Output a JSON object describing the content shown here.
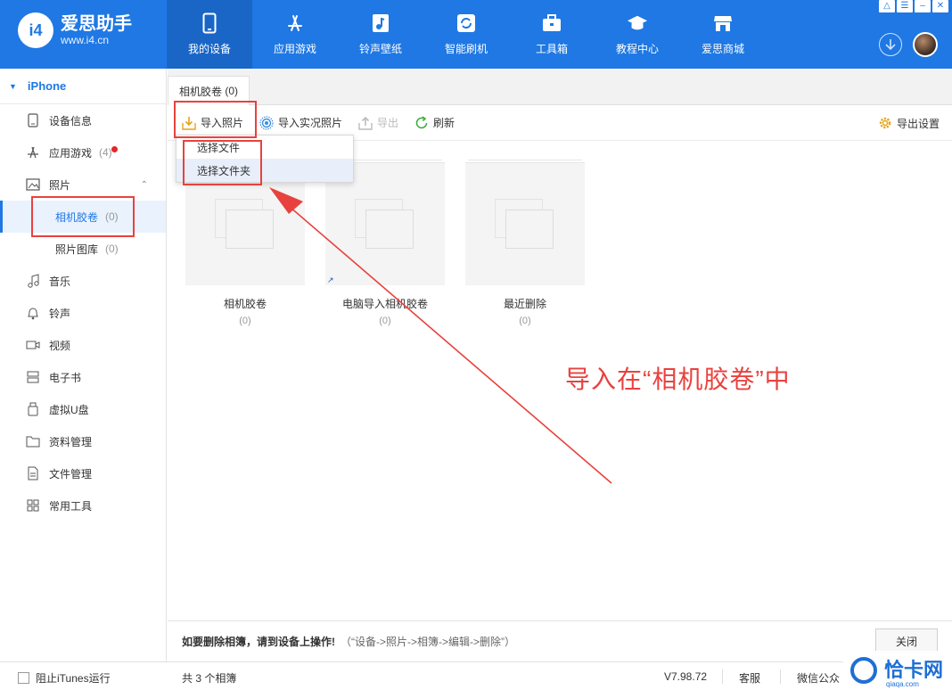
{
  "app": {
    "logo_badge": "i4",
    "name": "爱思助手",
    "url": "www.i4.cn",
    "window_controls": [
      "shirt-icon",
      "list-icon",
      "minimize-icon",
      "close-icon"
    ]
  },
  "nav": [
    {
      "label": "我的设备",
      "icon": "phone-icon",
      "active": true
    },
    {
      "label": "应用游戏",
      "icon": "appstore-icon"
    },
    {
      "label": "铃声壁纸",
      "icon": "music-file-icon"
    },
    {
      "label": "智能刷机",
      "icon": "refresh-box-icon"
    },
    {
      "label": "工具箱",
      "icon": "toolbox-icon"
    },
    {
      "label": "教程中心",
      "icon": "graduation-cap-icon"
    },
    {
      "label": "爱思商城",
      "icon": "store-icon"
    }
  ],
  "sidebar": {
    "device": "iPhone",
    "items": [
      {
        "label": "设备信息",
        "icon": "device-info-icon"
      },
      {
        "label": "应用游戏",
        "icon": "appstore-icon",
        "count": "(4)",
        "badge": true
      },
      {
        "label": "照片",
        "icon": "photo-icon"
      },
      {
        "label": "相机胶卷",
        "count": "(0)",
        "sub": true,
        "active": true
      },
      {
        "label": "照片图库",
        "count": "(0)",
        "sub": true
      },
      {
        "label": "音乐",
        "icon": "music-note-icon"
      },
      {
        "label": "铃声",
        "icon": "bell-icon"
      },
      {
        "label": "视频",
        "icon": "video-icon"
      },
      {
        "label": "电子书",
        "icon": "ebook-icon"
      },
      {
        "label": "虚拟U盘",
        "icon": "usb-drive-icon"
      },
      {
        "label": "资料管理",
        "icon": "folder-icon"
      },
      {
        "label": "文件管理",
        "icon": "file-icon"
      },
      {
        "label": "常用工具",
        "icon": "grid-icon"
      }
    ]
  },
  "tab": {
    "label": "相机胶卷",
    "count": "(0)"
  },
  "toolbar": {
    "import_photos": "导入照片",
    "import_live": "导入实况照片",
    "export": "导出",
    "refresh": "刷新",
    "export_settings": "导出设置"
  },
  "dropdown": [
    "选择文件",
    "选择文件夹"
  ],
  "albums": [
    {
      "name": "相机胶卷",
      "count": "(0)"
    },
    {
      "name": "电脑导入相机胶卷",
      "count": "(0)",
      "shortcut": true
    },
    {
      "name": "最近删除",
      "count": "(0)"
    }
  ],
  "annotation": "导入在“相机胶卷”中",
  "footer": {
    "tip": "如要删除相簿，请到设备上操作!",
    "path": "（“设备->照片->相簿->编辑->删除”）",
    "close": "关闭"
  },
  "statusbar": {
    "block_itunes": "阻止iTunes运行",
    "album_count": "共 3 个相簿",
    "version": "V7.98.72",
    "service": "客服",
    "wechat": "微信公众"
  },
  "watermark": {
    "text": "恰卡网",
    "sub": "qiaqa.com"
  },
  "colors": {
    "primary": "#1f78e4",
    "annotation": "#e8423e",
    "badge": "#e8252b"
  }
}
